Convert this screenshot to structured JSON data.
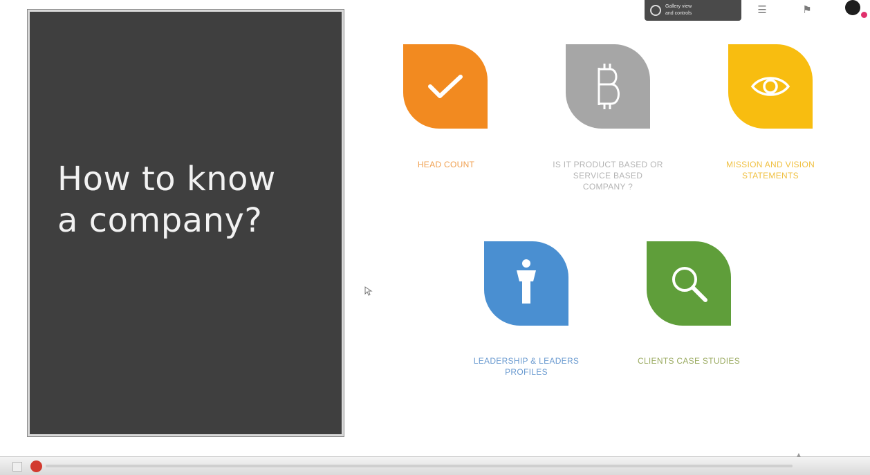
{
  "slide": {
    "title_line1": "How to know",
    "title_line2": "a company?"
  },
  "toolbar": {
    "zoom_text_line1": "Gallery view",
    "zoom_text_line2": "and controls"
  },
  "icons": [
    {
      "caption_line1": "HEAD COUNT",
      "caption_line2": "",
      "caption_line3": "",
      "color": "#f28a20",
      "icon": "checkmark-icon",
      "caption_color": "#f0a050"
    },
    {
      "caption_line1": "IS IT PRODUCT BASED OR",
      "caption_line2": "SERVICE BASED",
      "caption_line3": "COMPANY ?",
      "color": "#a6a6a6",
      "icon": "bitcoin-icon",
      "caption_color": "#b4b4b4"
    },
    {
      "caption_line1": "MISSION AND VISION",
      "caption_line2": "STATEMENTS",
      "caption_line3": "",
      "color": "#f8bd10",
      "icon": "eye-icon",
      "caption_color": "#f0c040"
    },
    {
      "caption_line1": "LEADERSHIP & LEADERS",
      "caption_line2": "PROFILES",
      "caption_line3": "",
      "color": "#4a8fd1",
      "icon": "person-icon",
      "caption_color": "#6a9ad0"
    },
    {
      "caption_line1": "CLIENTS CASE STUDIES",
      "caption_line2": "",
      "caption_line3": "",
      "color": "#5f9e3a",
      "icon": "magnifier-icon",
      "caption_color": "#9aaa60"
    }
  ]
}
